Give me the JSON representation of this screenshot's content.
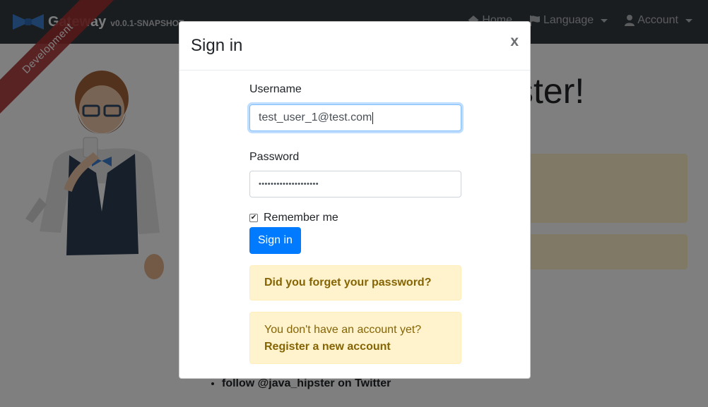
{
  "navbar": {
    "brand_name": "Gateway",
    "brand_version": "v0.0.1-SNAPSHOT",
    "items": [
      {
        "label": "Home",
        "icon": "home-icon"
      },
      {
        "label": "Language",
        "icon": "flag-icon"
      },
      {
        "label": "Account",
        "icon": "user-icon"
      }
    ]
  },
  "ribbon": {
    "label": "Development"
  },
  "hero": {
    "title_fragment": "ster!"
  },
  "background_list": {
    "item": "follow @java_hipster on Twitter"
  },
  "modal": {
    "title": "Sign in",
    "close_label": "x",
    "username_label": "Username",
    "username_value": "test_user_1@test.com",
    "password_label": "Password",
    "password_value": "••••••••••••••••••••",
    "remember_label": "Remember me",
    "remember_checked": true,
    "sign_in_label": "Sign in",
    "forgot_password": "Did you forget your password?",
    "no_account_text": "You don't have an account yet?",
    "register_link": "Register a new account"
  },
  "colors": {
    "navbar_bg": "#343a40",
    "primary": "#007bff",
    "warning_bg": "#fff3cd",
    "warning_text": "#856404",
    "ribbon": "#aa3232"
  }
}
